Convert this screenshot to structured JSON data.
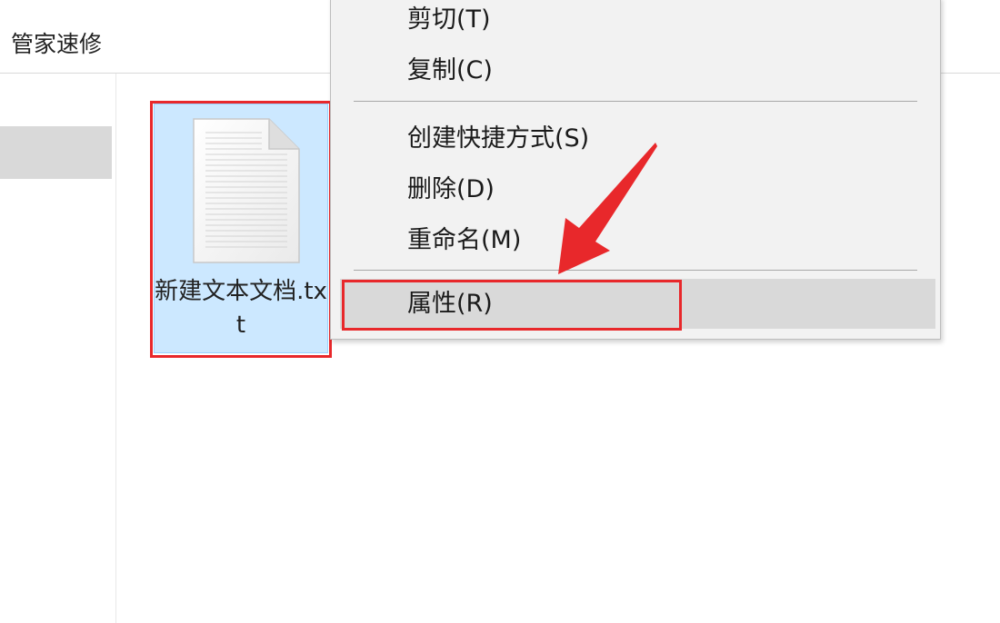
{
  "window": {
    "breadcrumb": "管家速修"
  },
  "file": {
    "name": "新建文本文档.txt",
    "icon": "text-file-icon",
    "selected": true
  },
  "context_menu": {
    "items": [
      {
        "label": "剪切(T)"
      },
      {
        "label": "复制(C)"
      },
      {
        "label": "创建快捷方式(S)"
      },
      {
        "label": "删除(D)"
      },
      {
        "label": "重命名(M)"
      },
      {
        "label": "属性(R)",
        "hovered": true
      }
    ]
  },
  "annotation": {
    "color": "#e8282b",
    "highlighted_file": "新建文本文档.txt",
    "highlighted_item": "属性(R)"
  },
  "colors": {
    "selection_bg": "#cce8ff",
    "selection_border": "#99d1ff",
    "menu_bg": "#f2f2f2",
    "hover_bg": "#d9d9d9"
  }
}
